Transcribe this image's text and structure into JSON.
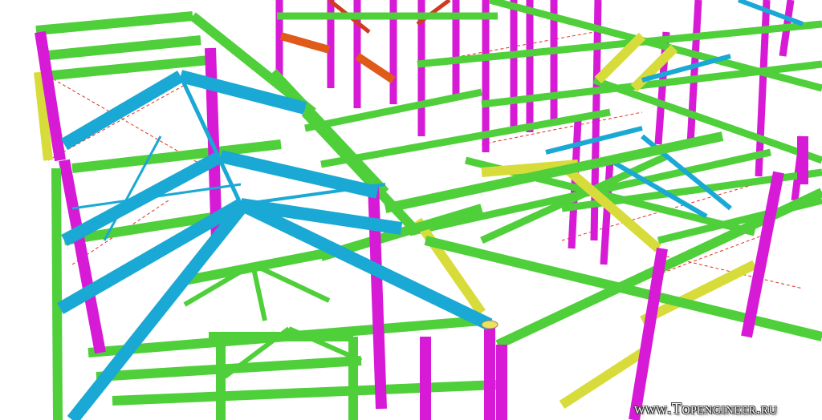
{
  "watermark": "www.Topengineer.ru",
  "colors": {
    "beam": "#4fcf3a",
    "column": "#d61ad6",
    "rafter": "#1aa8d4",
    "brace_beam": "#d8dc3a",
    "bracing_rod": "#e03020",
    "stair": "#e05a1a"
  }
}
